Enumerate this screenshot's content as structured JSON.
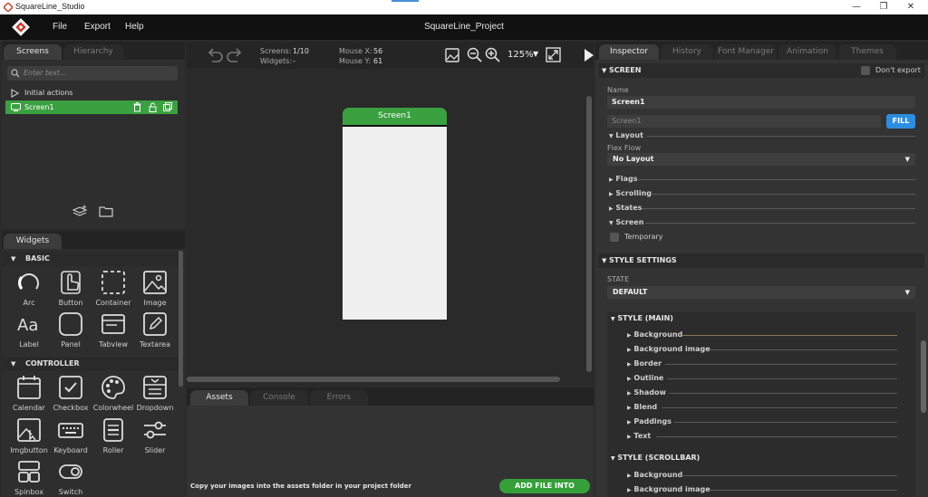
{
  "window": {
    "title": "SquareLine_Studio",
    "minimize": "—",
    "maximize": "❐",
    "close": "✕"
  },
  "menu": {
    "items": [
      "File",
      "Export",
      "Help"
    ],
    "project": "SquareLine_Project"
  },
  "left_top": {
    "tabs": [
      "Screens",
      "Hierarchy"
    ],
    "search_placeholder": "Enter text...",
    "initial_actions": "Initial actions",
    "screen_item": "Screen1"
  },
  "widgets": {
    "tab": "Widgets",
    "basic_title": "BASIC",
    "basic": [
      {
        "label": "Arc",
        "icon": "arc-icon"
      },
      {
        "label": "Button",
        "icon": "button-hand-icon"
      },
      {
        "label": "Container",
        "icon": "container-icon"
      },
      {
        "label": "Image",
        "icon": "image-icon"
      },
      {
        "label": "Label",
        "icon": "label-icon"
      },
      {
        "label": "Panel",
        "icon": "panel-icon"
      },
      {
        "label": "Tabview",
        "icon": "tabview-icon"
      },
      {
        "label": "Textarea",
        "icon": "textarea-icon"
      }
    ],
    "controller_title": "CONTROLLER",
    "controller": [
      {
        "label": "Calendar",
        "icon": "calendar-icon"
      },
      {
        "label": "Checkbox",
        "icon": "checkbox-icon"
      },
      {
        "label": "Colorwheel",
        "icon": "palette-icon"
      },
      {
        "label": "Dropdown",
        "icon": "dropdown-icon"
      },
      {
        "label": "Imgbutton",
        "icon": "imgbutton-icon"
      },
      {
        "label": "Keyboard",
        "icon": "keyboard-icon"
      },
      {
        "label": "Roller",
        "icon": "roller-icon"
      },
      {
        "label": "Slider",
        "icon": "slider-icon"
      },
      {
        "label": "Spinbox",
        "icon": "spinbox-icon"
      },
      {
        "label": "Switch",
        "icon": "switch-icon"
      }
    ]
  },
  "toolbar": {
    "screens_label": "Screens:",
    "screens_value": "1/10",
    "widgets_label": "Widgets:",
    "widgets_value": "-",
    "mousex_label": "Mouse X:",
    "mousex_value": "56",
    "mousey_label": "Mouse Y:",
    "mousey_value": "61",
    "zoom": "125%"
  },
  "canvas": {
    "screen_title": "Screen1"
  },
  "bottom": {
    "tabs": [
      "Assets",
      "Console",
      "Errors"
    ],
    "hint": "Copy your images into the assets folder in your project folder",
    "add_button": "ADD FILE INTO ASSETS"
  },
  "inspector": {
    "tabs": [
      "Inspector",
      "History",
      "Font Manager",
      "Animation",
      "Themes"
    ],
    "screen_section": "SCREEN",
    "dont_export": "Don't export",
    "name_label": "Name",
    "name_value": "Screen1",
    "fill_placeholder": "Screen1",
    "fill_button": "FILL",
    "layout": "Layout",
    "flex_flow_label": "Flex Flow",
    "flex_flow_value": "No Layout",
    "flags": "Flags",
    "scrolling": "Scrolling",
    "states": "States",
    "screen": "Screen",
    "temporary": "Temporary",
    "style_settings": "STYLE SETTINGS",
    "state_label": "STATE",
    "state_value": "DEFAULT",
    "style_main": "STYLE (MAIN)",
    "main_items": [
      "Background",
      "Background image",
      "Border",
      "Outline",
      "Shadow",
      "Blend",
      "Paddings",
      "Text"
    ],
    "style_scrollbar": "STYLE (SCROLLBAR)",
    "scrollbar_items": [
      "Background",
      "Background image"
    ]
  },
  "colors": {
    "accent_green": "#3aa040",
    "accent_blue": "#2d8ee0",
    "bg": "#2b2b2b"
  }
}
